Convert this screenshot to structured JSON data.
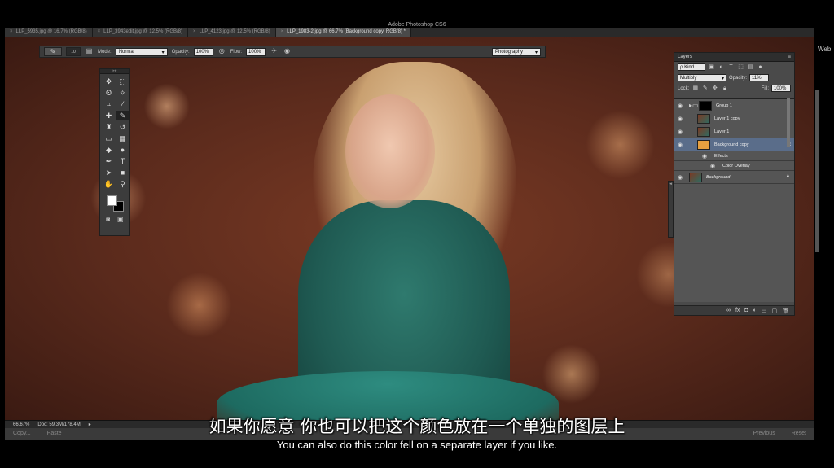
{
  "app": {
    "title": "Adobe Photoshop CS6"
  },
  "tabs": [
    {
      "label": "LLP_5935.jpg @ 16.7% (RGB/8)",
      "active": false
    },
    {
      "label": "LLP_3943edit.jpg @ 12.5% (RGB/8)",
      "active": false
    },
    {
      "label": "LLP_4123.jpg @ 12.5% (RGB/8)",
      "active": false
    },
    {
      "label": "LLP_1983-2.jpg @ 66.7% (Background copy, RGB/8) *",
      "active": true
    }
  ],
  "options_bar": {
    "brush_size": "10",
    "mode_label": "Mode:",
    "mode_value": "Normal",
    "opacity_label": "Opacity:",
    "opacity_value": "100%",
    "flow_label": "Flow:",
    "flow_value": "100%",
    "workspace": "Photography"
  },
  "layers_panel": {
    "title": "Layers",
    "kind": "ρ Kind",
    "blend_mode": "Multiply",
    "opacity_label": "Opacity:",
    "opacity_value": "11%",
    "lock_label": "Lock:",
    "fill_label": "Fill:",
    "fill_value": "100%",
    "layers": [
      {
        "name": "Group 1",
        "type": "group",
        "selected": false
      },
      {
        "name": "Layer 1 copy",
        "type": "layer",
        "selected": false
      },
      {
        "name": "Layer 1",
        "type": "layer",
        "selected": false
      },
      {
        "name": "Background copy",
        "type": "layer",
        "selected": true
      },
      {
        "name": "Effects",
        "type": "effects"
      },
      {
        "name": "Color Overlay",
        "type": "effect"
      },
      {
        "name": "Background",
        "type": "background",
        "selected": false
      }
    ],
    "fx_badge": "fx"
  },
  "side_text": "Web",
  "statusbar": {
    "zoom": "66.67%",
    "doc": "Doc: 59.3M/178.4M"
  },
  "bottom_buttons": {
    "copy": "Copy...",
    "paste": "Paste",
    "previous": "Previous",
    "reset": "Reset"
  },
  "subtitles": {
    "zh": "如果你愿意 你也可以把这个颜色放在一个单独的图层上",
    "en": "You can also do this color fell on a separate layer if you like."
  }
}
